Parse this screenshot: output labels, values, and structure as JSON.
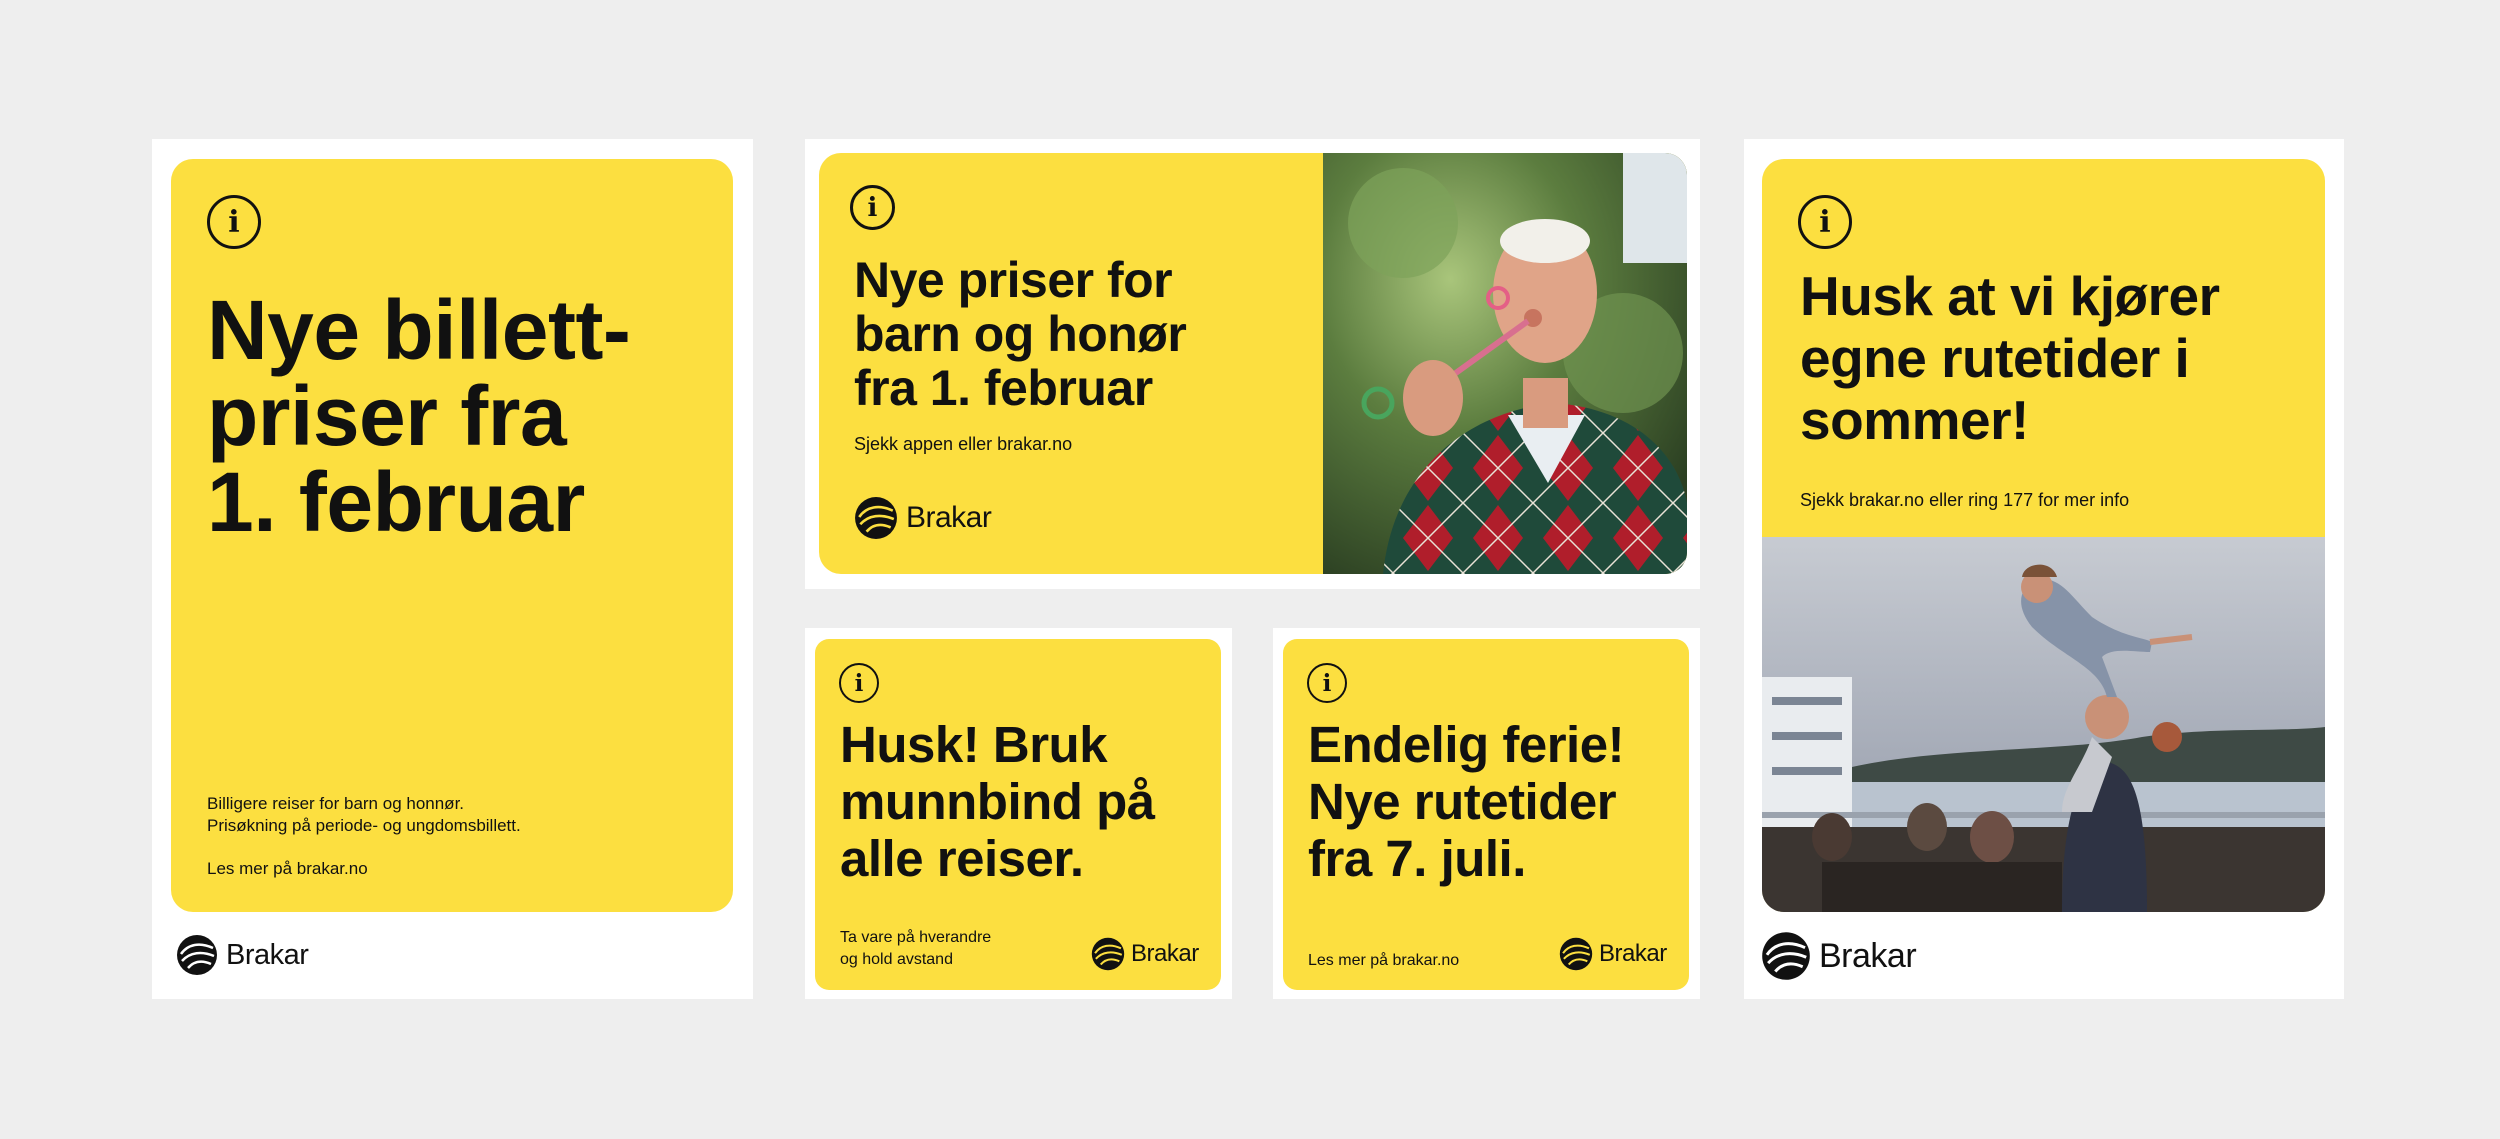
{
  "brand": {
    "name": "Brakar",
    "accent_color": "#fcdf40",
    "background_color": "#eeeeee",
    "frame_color": "#ffffff",
    "text_color": "#111111"
  },
  "ad_tall_left": {
    "icon": "info-icon",
    "headline": "Nye billett-\npriser fra\n1. februar",
    "body": "Billigere reiser for barn og honnør.\nPrisøkning på periode- og ungdomsbillett.",
    "link_text": "Les mer på brakar.no",
    "logo_text": "Brakar"
  },
  "ad_wide_top": {
    "icon": "info-icon",
    "headline": "Nye priser for\nbarn og honør\nfra 1. februar",
    "body": "Sjekk appen eller brakar.no",
    "logo_text": "Brakar",
    "photo": "elderly-man-blowing-bubbles-photo"
  },
  "ad_square_left": {
    "icon": "info-icon",
    "headline": "Husk! Bruk\nmunnbind på\nalle reiser.",
    "body": "Ta vare på hverandre\nog hold avstand",
    "logo_text": "Brakar"
  },
  "ad_square_right": {
    "icon": "info-icon",
    "headline": "Endelig ferie!\nNye rutetider\nfra 7. juli.",
    "body": "Les mer på brakar.no",
    "logo_text": "Brakar"
  },
  "ad_tall_right": {
    "icon": "info-icon",
    "headline": "Husk at vi kjører\negne rutetider i\nsommer!",
    "body": "Sjekk brakar.no eller ring 177 for mer info",
    "logo_text": "Brakar",
    "photo": "family-on-terrace-photo"
  }
}
